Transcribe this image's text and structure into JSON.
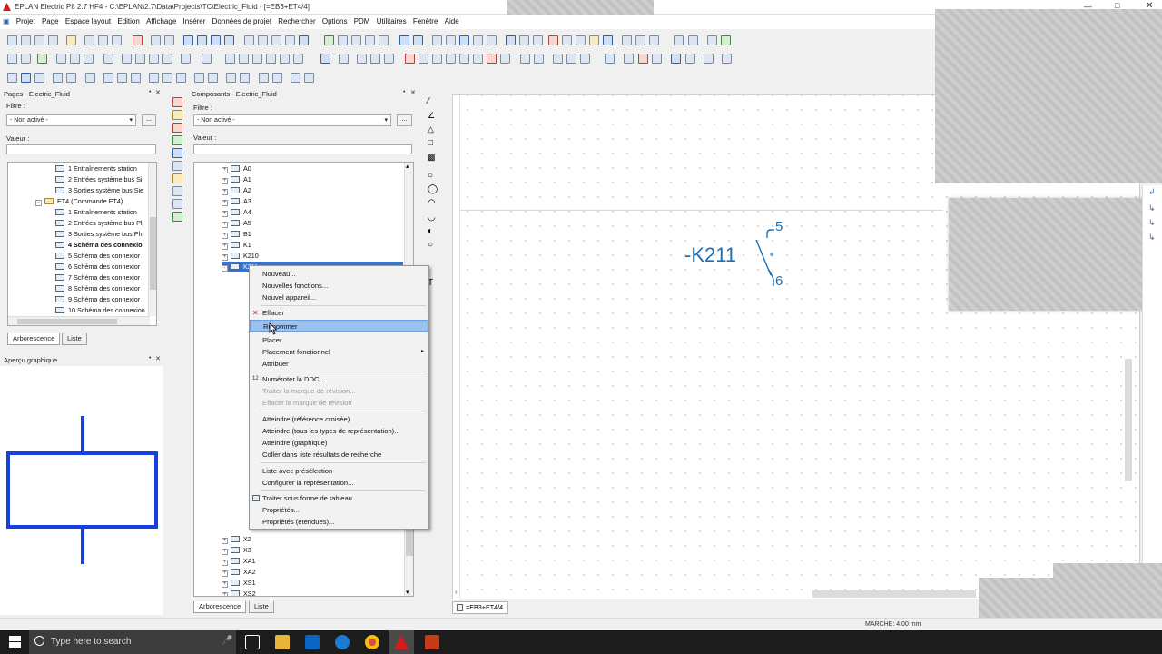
{
  "window": {
    "title": "EPLAN Electric P8 2.7 HF4 - C:\\EPLAN\\2.7\\Data\\Projects\\TC\\Electric_Fluid - [=EB3+ET4/4]"
  },
  "menu": [
    "Projet",
    "Page",
    "Espace layout",
    "Edition",
    "Affichage",
    "Insérer",
    "Données de projet",
    "Rechercher",
    "Options",
    "PDM",
    "Utilitaires",
    "Fenêtre",
    "Aide"
  ],
  "pages_panel": {
    "title": "Pages - Electric_Fluid",
    "filter_label": "Filtre :",
    "filter_value": "- Non activé -",
    "dots": "...",
    "value_label": "Valeur :",
    "tree": [
      "1 Entraînements station",
      "2 Entrées système bus Si",
      "3 Sorties système bus Sie",
      "ET4 (Commande ET4)",
      "1 Entraînements station",
      "2 Entrées système bus Pl",
      "3 Sorties système bus Ph",
      "4 Schéma des connexio",
      "5 Schéma des connexior",
      "6 Schéma des connexior",
      "7 Schéma des connexior",
      "8 Schéma des connexior",
      "9 Schéma des connexior",
      "10 Schéma des connexion"
    ],
    "tabs": [
      "Arborescence",
      "Liste"
    ]
  },
  "preview_panel": {
    "title": "Aperçu graphique"
  },
  "components_panel": {
    "title": "Composants - Electric_Fluid",
    "filter_label": "Filtre :",
    "filter_value": "- Non activé -",
    "dots": "...",
    "value_label": "Valeur :",
    "tree_top": [
      "A0",
      "A1",
      "A2",
      "A3",
      "A4",
      "A5",
      "B1",
      "K1",
      "K210",
      "K211"
    ],
    "tree_bottom": [
      "X2",
      "X3",
      "XA1",
      "XA2",
      "XS1",
      "XS2"
    ],
    "tabs": [
      "Arborescence",
      "Liste"
    ]
  },
  "context_menu": {
    "items": [
      {
        "label": "Nouveau...",
        "state": "normal"
      },
      {
        "label": "Nouvelles fonctions...",
        "state": "normal"
      },
      {
        "label": "Nouvel appareil...",
        "state": "normal"
      },
      {
        "label": "Effacer",
        "state": "normal"
      },
      {
        "label": "Renommer",
        "state": "highlighted"
      },
      {
        "label": "Placer",
        "state": "normal"
      },
      {
        "label": "Placement fonctionnel",
        "state": "normal"
      },
      {
        "label": "Attribuer",
        "state": "normal"
      },
      {
        "label": "Numéroter la DDC...",
        "state": "normal"
      },
      {
        "label": "Traiter la marque de révision...",
        "state": "disabled"
      },
      {
        "label": "Effacer la marque de révision",
        "state": "disabled"
      },
      {
        "label": "Atteindre (référence croisée)",
        "state": "normal"
      },
      {
        "label": "Atteindre (tous les types de représentation)...",
        "state": "normal"
      },
      {
        "label": "Atteindre (graphique)",
        "state": "normal"
      },
      {
        "label": "Coller dans liste résultats de recherche",
        "state": "normal"
      },
      {
        "label": "Liste avec présélection",
        "state": "normal"
      },
      {
        "label": "Configurer la représentation...",
        "state": "normal"
      },
      {
        "label": "Traiter sous forme de tableau",
        "state": "normal"
      },
      {
        "label": "Propriétés...",
        "state": "normal"
      },
      {
        "label": "Propriétés (étendues)...",
        "state": "normal"
      }
    ]
  },
  "schematic": {
    "device_label": "-K211",
    "terminal_top": "5",
    "terminal_bottom": "6",
    "color": "#1f6fb5"
  },
  "page_tab": "=EB3+ET4/4",
  "status": {
    "text": "MARCHE: 4.00 mm"
  },
  "taskbar": {
    "search_placeholder": "Type here to search"
  }
}
